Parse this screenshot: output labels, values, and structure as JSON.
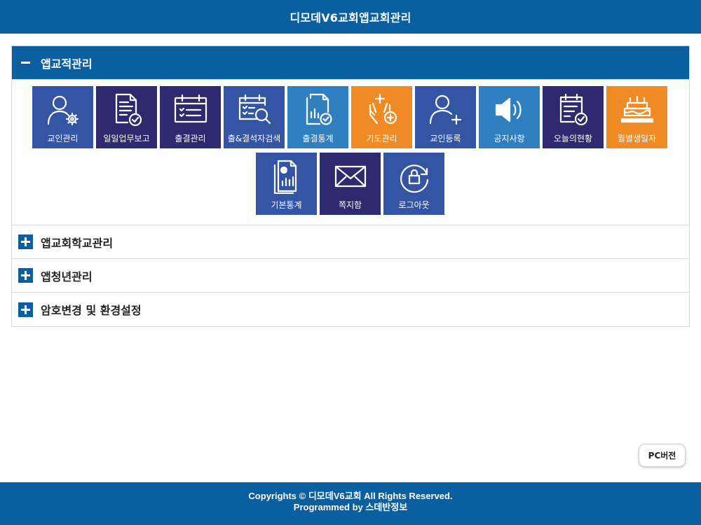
{
  "header": {
    "title": "디모데V6교회앱교회관리"
  },
  "sections": [
    {
      "title": "앱교적관리",
      "expanded": true
    },
    {
      "title": "앱교회학교관리",
      "expanded": false
    },
    {
      "title": "앱청년관리",
      "expanded": false
    },
    {
      "title": "암호변경 및 환경설정",
      "expanded": false
    }
  ],
  "tiles": [
    {
      "label": "교인관리",
      "icon": "member-settings-icon",
      "color": "#3454a4"
    },
    {
      "label": "일일업무보고",
      "icon": "report-check-icon",
      "color": "#2d2a6f"
    },
    {
      "label": "출결관리",
      "icon": "attendance-calendar-icon",
      "color": "#2d2a6f"
    },
    {
      "label": "출&결석자검색",
      "icon": "attendance-search-icon",
      "color": "#3454a4"
    },
    {
      "label": "출결통계",
      "icon": "attendance-stats-icon",
      "color": "#2f7fc1"
    },
    {
      "label": "기도관리",
      "icon": "praying-hands-icon",
      "color": "#f08a24"
    },
    {
      "label": "교인등록",
      "icon": "add-member-icon",
      "color": "#3454a4"
    },
    {
      "label": "공지사항",
      "icon": "speaker-icon",
      "color": "#2f7fc1"
    },
    {
      "label": "오늘의현황",
      "icon": "today-status-icon",
      "color": "#2d2a6f"
    },
    {
      "label": "월별생일자",
      "icon": "birthday-cake-icon",
      "color": "#f08a24"
    },
    {
      "label": "기본통계",
      "icon": "basic-stats-icon",
      "color": "#3454a4"
    },
    {
      "label": "쪽지함",
      "icon": "envelope-icon",
      "color": "#2d2a6f"
    },
    {
      "label": "로그아웃",
      "icon": "logout-lock-icon",
      "color": "#3454a4"
    }
  ],
  "pc_button": {
    "label": "PC버전"
  },
  "footer": {
    "line1": "Copyrights © 디모데V6교회 All Rights Reserved.",
    "line2": "Programmed by 스데반정보"
  }
}
